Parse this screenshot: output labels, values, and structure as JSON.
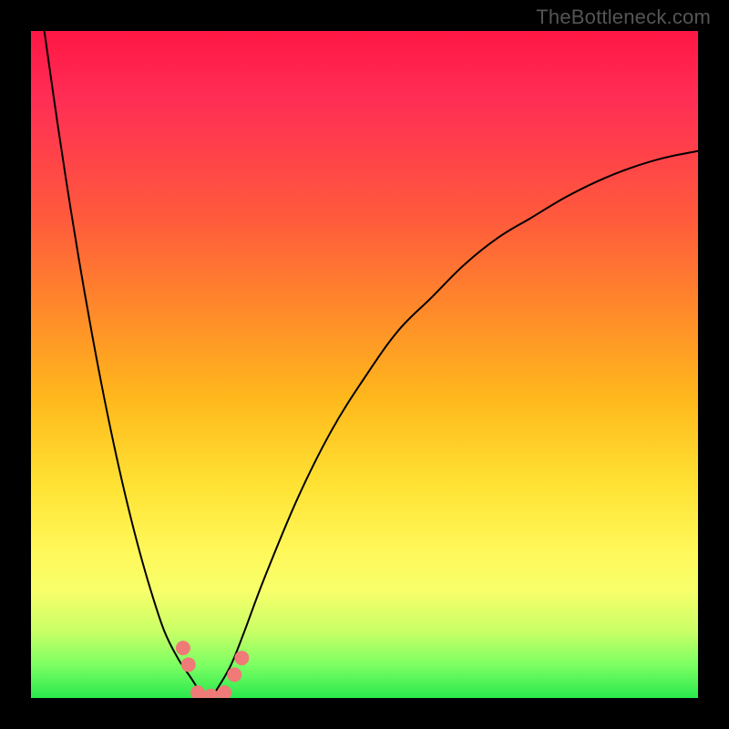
{
  "watermark": {
    "text": "TheBottleneck.com"
  },
  "chart_data": {
    "type": "line",
    "title": "",
    "xlabel": "",
    "ylabel": "",
    "xlim": [
      0,
      100
    ],
    "ylim": [
      0,
      100
    ],
    "grid": false,
    "legend": false,
    "series": [
      {
        "name": "left-branch",
        "x": [
          2,
          4,
          6,
          8,
          10,
          12,
          14,
          16,
          18,
          20,
          22,
          24,
          25,
          26,
          27
        ],
        "values": [
          100,
          86,
          73,
          61,
          50,
          40,
          31,
          23,
          16,
          10,
          6,
          3,
          1.5,
          0.5,
          0
        ]
      },
      {
        "name": "right-branch",
        "x": [
          27,
          28,
          30,
          32,
          35,
          40,
          45,
          50,
          55,
          60,
          65,
          70,
          75,
          80,
          85,
          90,
          95,
          100
        ],
        "values": [
          0,
          1.5,
          5,
          10,
          18,
          30,
          40,
          48,
          55,
          60,
          65,
          69,
          72,
          75,
          77.5,
          79.5,
          81,
          82
        ]
      }
    ],
    "markers": [
      {
        "name": "dot-left-upper",
        "x": 22.8,
        "y": 7.5
      },
      {
        "name": "dot-left-lower",
        "x": 23.6,
        "y": 5.0
      },
      {
        "name": "dot-floor-1",
        "x": 25.0,
        "y": 0.8
      },
      {
        "name": "dot-floor-2",
        "x": 27.0,
        "y": 0.3
      },
      {
        "name": "dot-floor-3",
        "x": 29.0,
        "y": 0.8
      },
      {
        "name": "dot-right-lower",
        "x": 30.5,
        "y": 3.5
      },
      {
        "name": "dot-right-upper",
        "x": 31.6,
        "y": 6.0
      }
    ],
    "marker_style": {
      "color": "#ef7a78",
      "radius_px": 8
    }
  }
}
